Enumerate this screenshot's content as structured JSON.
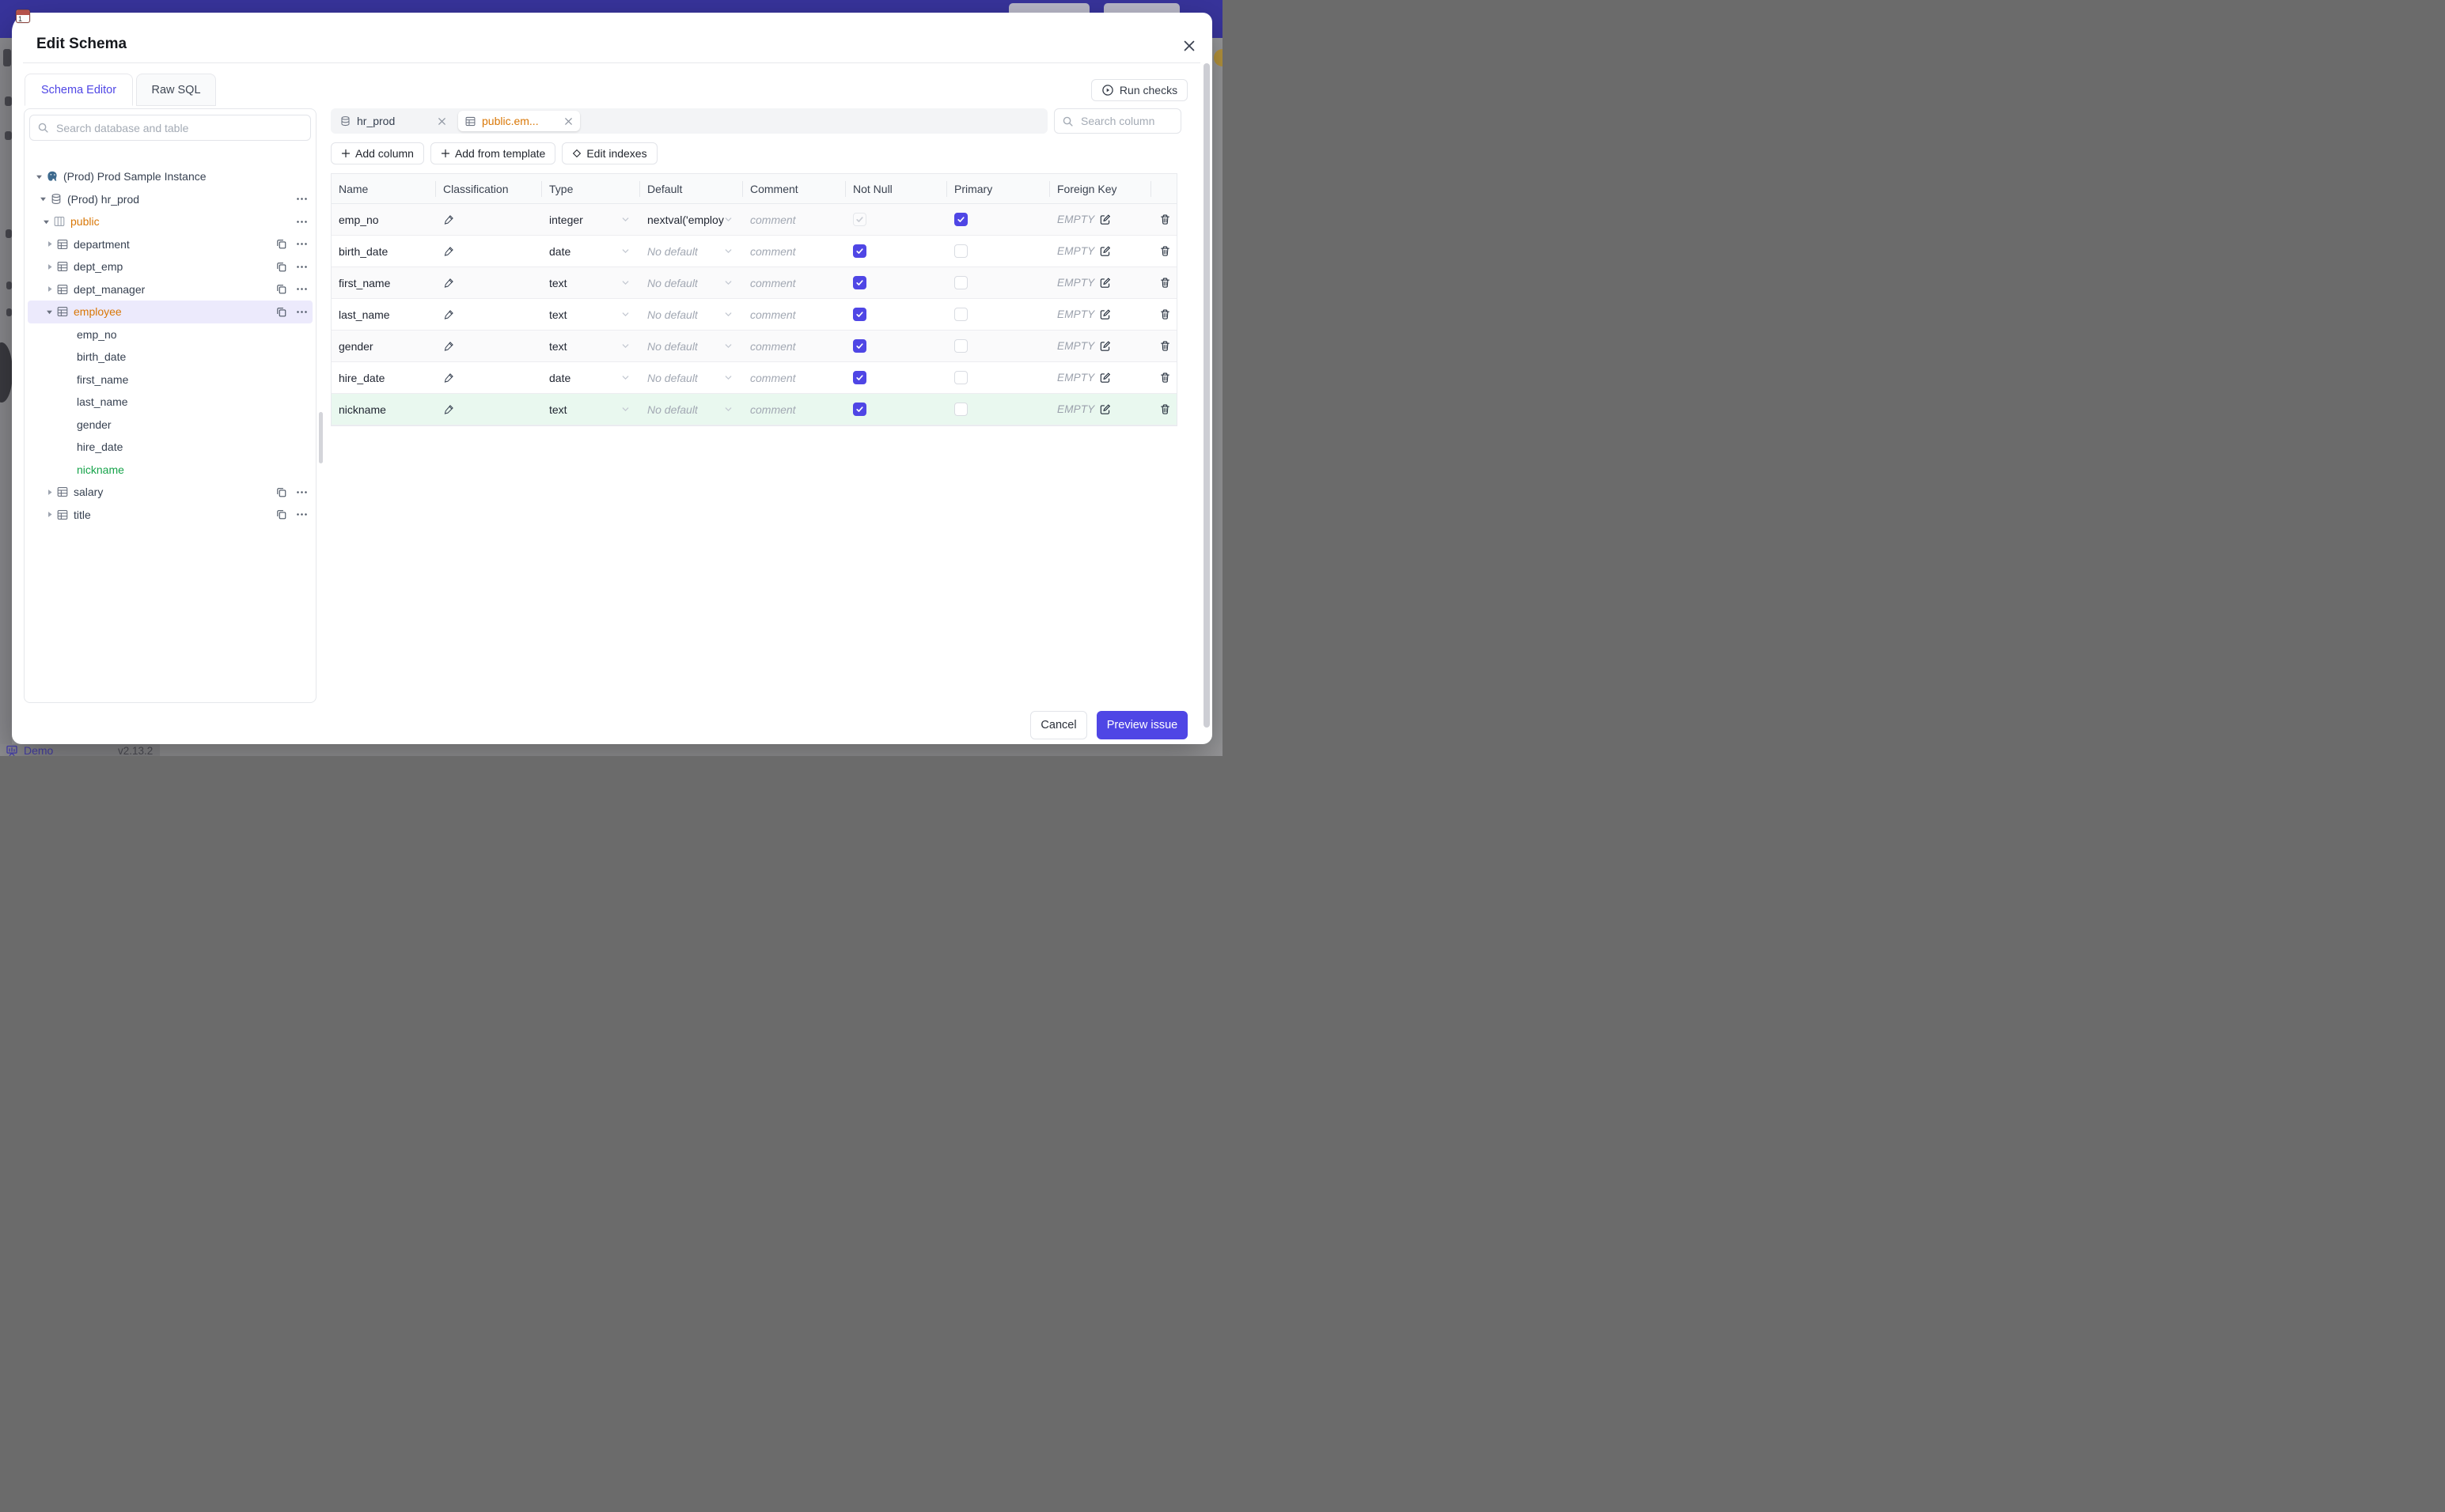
{
  "background": {
    "logo_badge": "1",
    "demo_label": "Demo",
    "version": "v2.13.2"
  },
  "modal": {
    "title": "Edit Schema",
    "tabs": {
      "schema_editor": "Schema Editor",
      "raw_sql": "Raw SQL"
    },
    "run_checks_label": "Run checks",
    "sidebar": {
      "search_placeholder": "Search database and table",
      "tree": [
        {
          "label": "(Prod) Prod Sample Instance",
          "type": "instance"
        },
        {
          "label": "(Prod) hr_prod",
          "type": "database"
        },
        {
          "label": "public",
          "type": "schema",
          "color": "orange"
        },
        {
          "label": "department",
          "type": "table"
        },
        {
          "label": "dept_emp",
          "type": "table"
        },
        {
          "label": "dept_manager",
          "type": "table"
        },
        {
          "label": "employee",
          "type": "table",
          "color": "orange",
          "selected": true
        },
        {
          "label": "emp_no",
          "type": "column"
        },
        {
          "label": "birth_date",
          "type": "column"
        },
        {
          "label": "first_name",
          "type": "column"
        },
        {
          "label": "last_name",
          "type": "column"
        },
        {
          "label": "gender",
          "type": "column"
        },
        {
          "label": "hire_date",
          "type": "column"
        },
        {
          "label": "nickname",
          "type": "column",
          "color": "green"
        },
        {
          "label": "salary",
          "type": "table"
        },
        {
          "label": "title",
          "type": "table"
        }
      ]
    },
    "main": {
      "chips": {
        "database_chip": "hr_prod",
        "table_chip": "public.em..."
      },
      "search_column_placeholder": "Search column",
      "toolbar": {
        "add_column": "Add column",
        "add_from_template": "Add from template",
        "edit_indexes": "Edit indexes"
      },
      "table": {
        "headers": {
          "name": "Name",
          "classification": "Classification",
          "type": "Type",
          "default": "Default",
          "comment": "Comment",
          "not_null": "Not Null",
          "primary": "Primary",
          "foreign_key": "Foreign Key"
        },
        "comment_placeholder": "comment",
        "empty_label": "EMPTY",
        "rows": [
          {
            "name": "emp_no",
            "type": "integer",
            "default": "nextval('employ",
            "default_kind": "value",
            "not_null": "checked-disabled",
            "primary": "checked"
          },
          {
            "name": "birth_date",
            "type": "date",
            "default": "No default",
            "default_kind": "placeholder",
            "not_null": "checked",
            "primary": "unchecked"
          },
          {
            "name": "first_name",
            "type": "text",
            "default": "No default",
            "default_kind": "placeholder",
            "not_null": "checked",
            "primary": "unchecked"
          },
          {
            "name": "last_name",
            "type": "text",
            "default": "No default",
            "default_kind": "placeholder",
            "not_null": "checked",
            "primary": "unchecked"
          },
          {
            "name": "gender",
            "type": "text",
            "default": "No default",
            "default_kind": "placeholder",
            "not_null": "checked",
            "primary": "unchecked"
          },
          {
            "name": "hire_date",
            "type": "date",
            "default": "No default",
            "default_kind": "placeholder",
            "not_null": "checked",
            "primary": "unchecked"
          },
          {
            "name": "nickname",
            "type": "text",
            "default": "No default",
            "default_kind": "placeholder",
            "not_null": "checked",
            "primary": "unchecked",
            "variant": "new"
          }
        ]
      }
    },
    "footer": {
      "cancel_label": "Cancel",
      "primary_label": "Preview issue"
    }
  },
  "colors": {
    "accent": "#4f46e5",
    "topbar": "#38349c",
    "modified_orange": "#d97706",
    "added_green": "#16a34a",
    "new_row_bg": "#e9f8ef",
    "selected_tree_bg": "#eceafc"
  }
}
